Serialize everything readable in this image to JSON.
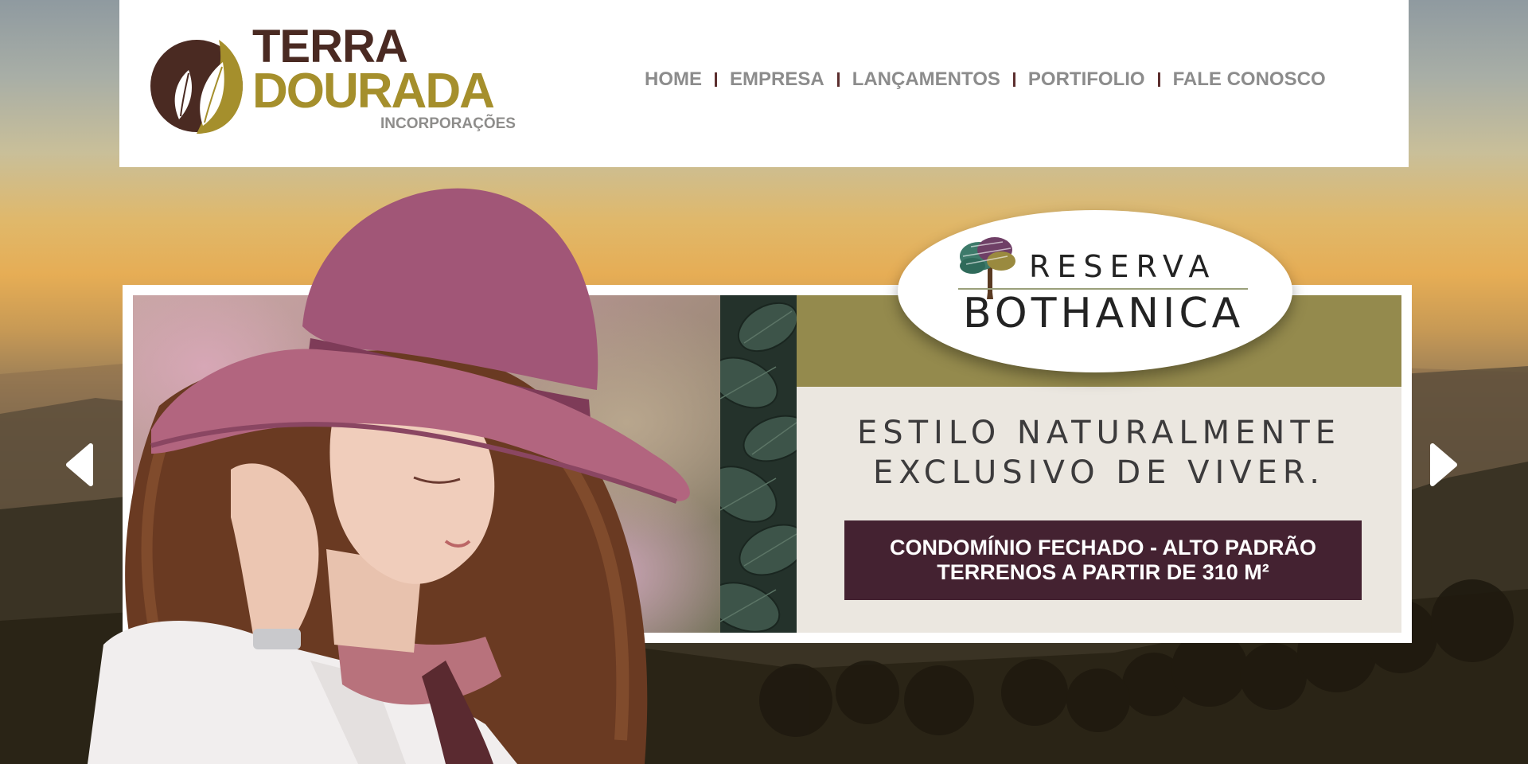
{
  "brand": {
    "line1": "TERRA",
    "line2": "DOURADA",
    "line3": "INCORPORAÇÕES",
    "colors": {
      "brown": "#4a2a22",
      "gold": "#a58f2c",
      "gray": "#8e8d8b"
    }
  },
  "nav": {
    "items": [
      "HOME",
      "EMPRESA",
      "LANÇAMENTOS",
      "PORTIFOLIO",
      "FALE CONOSCO"
    ],
    "separator_color": "#5c2e2e",
    "text_color": "#8c8c8c"
  },
  "slide": {
    "badge": {
      "word1": "RESERVA",
      "word2": "BOTHANICA"
    },
    "tagline": {
      "line1": "ESTILO NATURALMENTE",
      "line2": "EXCLUSIVO DE VIVER."
    },
    "cta": {
      "line1": "CONDOMÍNIO FECHADO - ALTO PADRÃO",
      "line2": "TERRENOS A PARTIR DE 310 M²"
    },
    "colors": {
      "olive": "#948a4d",
      "panel": "#ebe7e0",
      "cta": "#442231"
    }
  },
  "icons": {
    "prev": "chevron-left-icon",
    "next": "chevron-right-icon",
    "logo": "leaf-logo-icon",
    "tree": "tree-icon"
  }
}
